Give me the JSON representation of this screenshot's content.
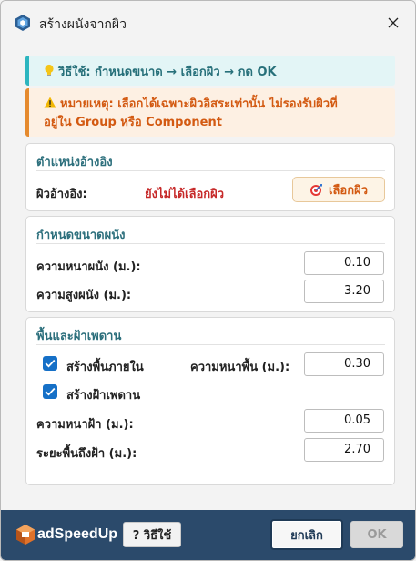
{
  "window": {
    "title": "สร้างผนังจากผิว",
    "close_glyph": "✕"
  },
  "tip": {
    "icon": "lightbulb-icon",
    "text": "วิธีใช้: กำหนดขนาด → เลือกผิว → กด OK"
  },
  "warning": {
    "icon": "warning-icon",
    "line1": "หมายเหตุ: เลือกได้เฉพาะผิวอิสระเท่านั้น ไม่รองรับผิวที่",
    "line2": "อยู่ใน Group หรือ Component"
  },
  "reference": {
    "title": "ตำแหน่งอ้างอิง",
    "label": "ผิวอ้างอิง:",
    "status": "ยังไม่ได้เลือกผิว",
    "pick_button": "เลือกผิว",
    "pick_icon": "target-icon"
  },
  "wall_size": {
    "title": "กำหนดขนาดผนัง",
    "thickness_label": "ความหนาผนัง (ม.):",
    "thickness_value": "0.10",
    "height_label": "ความสูงผนัง (ม.):",
    "height_value": "3.20"
  },
  "floor_ceiling": {
    "title": "พื้นและฝ้าเพดาน",
    "create_floor_label": "สร้างพื้นภายใน",
    "create_floor_checked": true,
    "floor_thickness_label": "ความหนาพื้น (ม.):",
    "floor_thickness_value": "0.30",
    "create_ceiling_label": "สร้างฝ้าเพดาน",
    "create_ceiling_checked": true,
    "ceiling_thickness_label": "ความหนาฝ้า (ม.):",
    "ceiling_thickness_value": "0.05",
    "floor_to_ceiling_label": "ระยะพื้นถึงฝ้า (ม.):",
    "floor_to_ceiling_value": "2.70"
  },
  "footer": {
    "logo_text": "adSpeedUp",
    "help_button": "? วิธีใช้",
    "cancel_button": "ยกเลิก",
    "ok_button": "OK"
  },
  "colors": {
    "accent_teal": "#2c6f7c",
    "warning_orange": "#d35a12",
    "error_red": "#c62828",
    "footer_bg": "#2b4a6b",
    "checkbox_blue": "#1670c7"
  }
}
